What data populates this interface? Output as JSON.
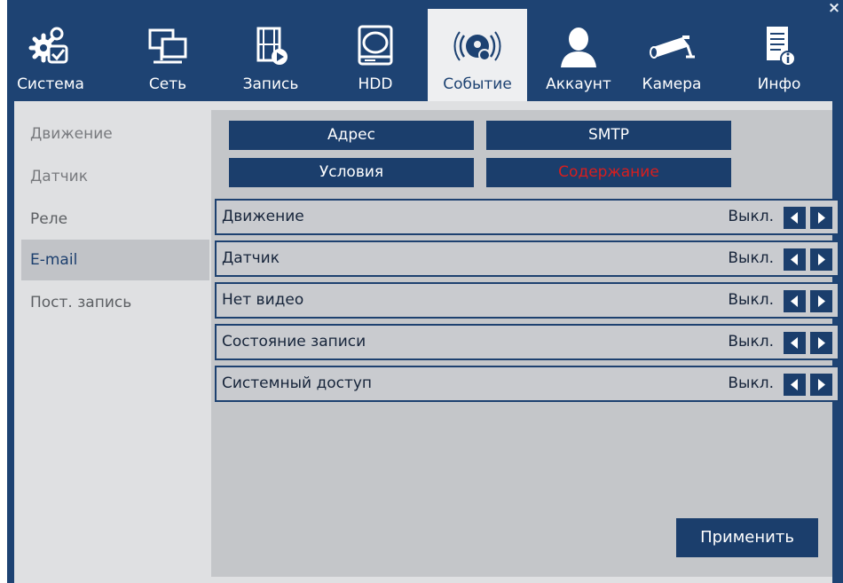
{
  "window": {
    "close_label": "×"
  },
  "tabs": [
    {
      "label": "Система",
      "icon": "gear-check-icon"
    },
    {
      "label": "Сеть",
      "icon": "network-monitors-icon"
    },
    {
      "label": "Запись",
      "icon": "film-record-icon"
    },
    {
      "label": "HDD",
      "icon": "hard-drive-icon"
    },
    {
      "label": "Событие",
      "icon": "alarm-event-icon",
      "active": true
    },
    {
      "label": "Аккаунт",
      "icon": "user-account-icon"
    },
    {
      "label": "Камера",
      "icon": "bullet-camera-icon"
    },
    {
      "label": "Инфо",
      "icon": "info-document-icon"
    }
  ],
  "sidebar": {
    "items": [
      {
        "label": "Движение"
      },
      {
        "label": "Датчик"
      },
      {
        "label": "Реле"
      },
      {
        "label": "E-mail",
        "active": true
      },
      {
        "label": "Пост. запись"
      }
    ]
  },
  "subtabs": {
    "address": "Адрес",
    "smtp": "SMTP",
    "conditions": "Условия",
    "content": "Содержание"
  },
  "rows": [
    {
      "label": "Движение",
      "value": "Выкл."
    },
    {
      "label": "Датчик",
      "value": "Выкл."
    },
    {
      "label": "Нет видео",
      "value": "Выкл."
    },
    {
      "label": "Состояние записи",
      "value": "Выкл."
    },
    {
      "label": "Системный доступ",
      "value": "Выкл."
    }
  ],
  "apply_label": "Применить",
  "colors": {
    "frame": "#1e4373",
    "button": "#1b3e6c",
    "selected_text": "#d81e1e",
    "content_bg": "#dfe0e2",
    "panel_bg": "#c4c6c9"
  }
}
